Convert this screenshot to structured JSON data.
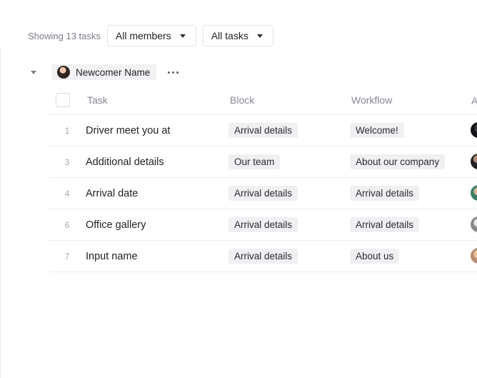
{
  "toolbar": {
    "showing": "Showing 13 tasks",
    "members_filter": "All members",
    "tasks_filter": "All tasks"
  },
  "group": {
    "name": "Newcomer Name"
  },
  "table": {
    "headers": {
      "task": "Task",
      "block": "Block",
      "workflow": "Workflow",
      "assignee_partial": "A"
    },
    "rows": [
      {
        "num": "1",
        "task": "Driver meet you at",
        "block": "Arrival details",
        "workflow": "Welcome!"
      },
      {
        "num": "3",
        "task": "Additional details",
        "block": "Our team",
        "workflow": "About our company"
      },
      {
        "num": "4",
        "task": "Arrival date",
        "block": "Arrival details",
        "workflow": "Arrival details"
      },
      {
        "num": "6",
        "task": "Office gallery",
        "block": "Arrival details",
        "workflow": "Arrival details"
      },
      {
        "num": "7",
        "task": "Input name",
        "block": "Arrival details",
        "workflow": "About us"
      }
    ]
  },
  "icons": [
    "caret-down-icon",
    "collapse-icon",
    "more-dots-icon"
  ]
}
